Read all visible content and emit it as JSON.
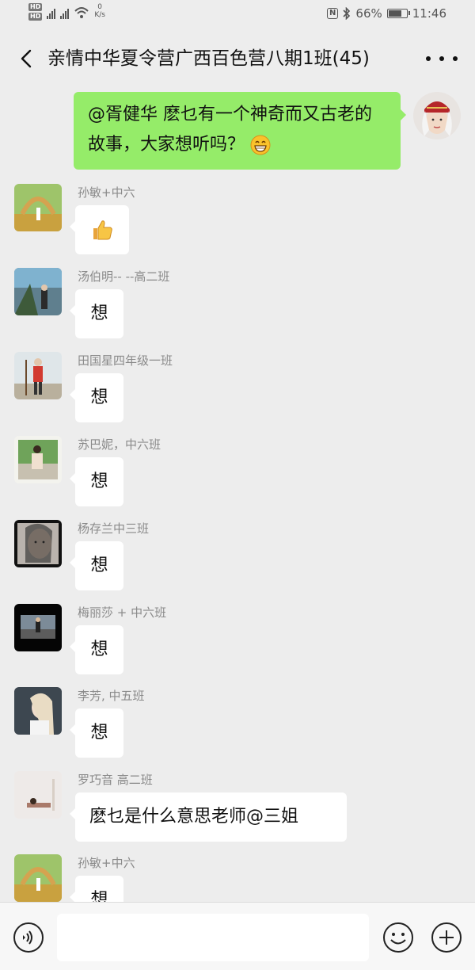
{
  "status_bar": {
    "hd_label": "HD",
    "net_speed_value": "0",
    "net_speed_unit": "K/s",
    "battery": "66%",
    "time": "11:46",
    "battery_level": 0.66
  },
  "header": {
    "title": "亲情中华夏令营广西百色营八期1班(45)"
  },
  "messages": [
    {
      "self": true,
      "text": "@胥健华  麽乜有一个神奇而又古老的故事，大家想听吗？",
      "emoji": "grinning-face-emoji"
    },
    {
      "sender": "孙敏+中六",
      "emoji": "thumbs-up-emoji"
    },
    {
      "sender": "汤伯明-- --高二班",
      "text": "想"
    },
    {
      "sender": "田国星四年级一班",
      "text": "想"
    },
    {
      "sender": "苏巴妮，中六班",
      "text": "想"
    },
    {
      "sender": "杨存兰中三班",
      "text": "想"
    },
    {
      "sender": "梅丽莎 + 中六班",
      "text": "想"
    },
    {
      "sender": "李芳, 中五班",
      "text": "想"
    },
    {
      "sender": "罗巧音 高二班",
      "text": "麽乜是什么意思老师@三姐"
    },
    {
      "sender": "孙敏+中六",
      "text": "想"
    }
  ],
  "input_bar": {
    "placeholder": "",
    "icons": [
      "voice-icon",
      "emoji-icon",
      "plus-icon"
    ]
  },
  "colors": {
    "self_bubble": "#95ec69",
    "other_bubble": "#ffffff",
    "background": "#ededed"
  }
}
